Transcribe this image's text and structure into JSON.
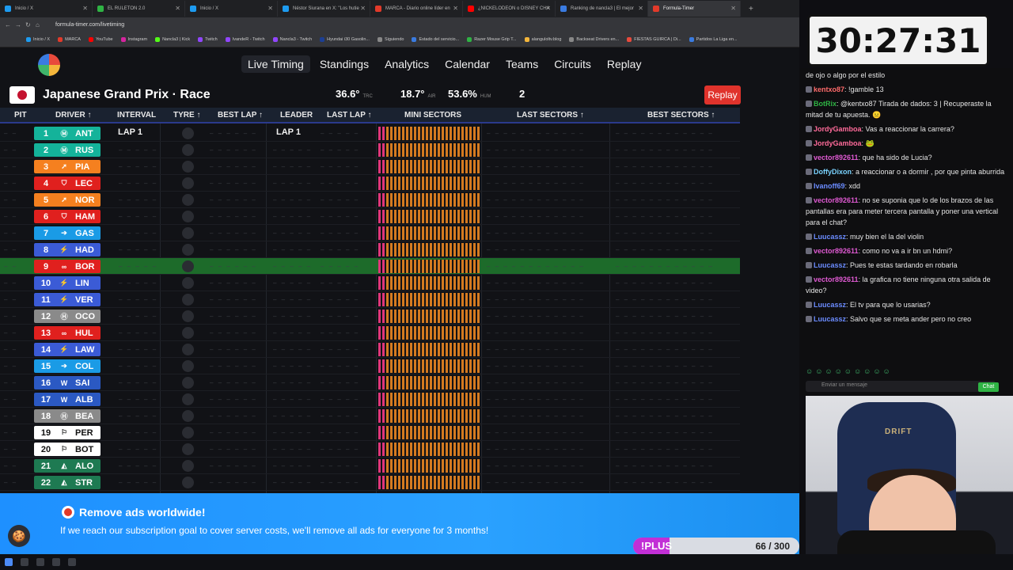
{
  "browser": {
    "tabs": [
      {
        "label": "Inicio / X",
        "color": "#1d9bf0"
      },
      {
        "label": "EL RULETON 2.0",
        "color": "#2fb344"
      },
      {
        "label": "Inicio / X",
        "color": "#1d9bf0"
      },
      {
        "label": "Néstor Siurana en X: \"Los hutie",
        "color": "#1d9bf0"
      },
      {
        "label": "MARCA - Diario online líder en",
        "color": "#e23a2a"
      },
      {
        "label": "¿NICKELODEON o DISNEY CHA",
        "color": "#ff0000"
      },
      {
        "label": "Ranking de nancla3 | El mejor",
        "color": "#3a7be0"
      },
      {
        "label": "Formula-Timer",
        "color": "#e23a2a",
        "active": true
      }
    ],
    "url": "formula-timer.com/livetiming",
    "bookmarks": [
      "Inicio / X",
      "MARCA",
      "YouTube",
      "Instagram",
      "Nancla3 | Kick",
      "Twitch",
      "IvandeR - Twitch",
      "Nancla3 - Twitch",
      "Hyundai i30 Gasolin...",
      "Siguiendo",
      "Estado del servicio...",
      "Razer Mouse Grip T...",
      "alanguloltv.blog",
      "Backseat Drivers en...",
      "FIESTAS GUIRCA | Di...",
      "Partidos La Liga en..."
    ]
  },
  "site": {
    "nav": [
      "Live Timing",
      "Standings",
      "Analytics",
      "Calendar",
      "Teams",
      "Circuits",
      "Replay"
    ],
    "race_title": "Japanese Grand Prix · Race",
    "weather": [
      {
        "value": "36.6°",
        "label": "TRC"
      },
      {
        "value": "18.7°",
        "label": "AIR"
      },
      {
        "value": "53.6%",
        "label": "HUM"
      },
      {
        "value": "2",
        "label": ""
      }
    ],
    "replay_button": "Replay",
    "columns": [
      "PIT",
      "DRIVER ↑",
      "INTERVAL",
      "TYRE ↑",
      "BEST LAP ↑",
      "LEADER",
      "LAST LAP ↑",
      "MINI SECTORS",
      "LAST SECTORS ↑",
      "BEST SECTORS ↑"
    ],
    "lap_label": "LAP 1",
    "drivers": [
      {
        "pos": "1",
        "code": "ANT",
        "color": "#14b39a",
        "logo": "Ⓜ"
      },
      {
        "pos": "2",
        "code": "RUS",
        "color": "#14b39a",
        "logo": "Ⓜ"
      },
      {
        "pos": "3",
        "code": "PIA",
        "color": "#f5801f",
        "logo": "➚"
      },
      {
        "pos": "4",
        "code": "LEC",
        "color": "#e0201e",
        "logo": "⛉"
      },
      {
        "pos": "5",
        "code": "NOR",
        "color": "#f5801f",
        "logo": "➚"
      },
      {
        "pos": "6",
        "code": "HAM",
        "color": "#e0201e",
        "logo": "⛉"
      },
      {
        "pos": "7",
        "code": "GAS",
        "color": "#1a9be6",
        "logo": "➔"
      },
      {
        "pos": "8",
        "code": "HAD",
        "color": "#3b5bd6",
        "logo": "⚡"
      },
      {
        "pos": "9",
        "code": "BOR",
        "color": "#e0201e",
        "logo": "∞"
      },
      {
        "pos": "10",
        "code": "LIN",
        "color": "#3b5bd6",
        "logo": "⚡"
      },
      {
        "pos": "11",
        "code": "VER",
        "color": "#3b5bd6",
        "logo": "⚡"
      },
      {
        "pos": "12",
        "code": "OCO",
        "color": "#8a8a8a",
        "logo": "Ⓗ"
      },
      {
        "pos": "13",
        "code": "HUL",
        "color": "#e0201e",
        "logo": "∞"
      },
      {
        "pos": "14",
        "code": "LAW",
        "color": "#3b5bd6",
        "logo": "⚡"
      },
      {
        "pos": "15",
        "code": "COL",
        "color": "#1a9be6",
        "logo": "➔"
      },
      {
        "pos": "16",
        "code": "SAI",
        "color": "#2b59c3",
        "logo": "W"
      },
      {
        "pos": "17",
        "code": "ALB",
        "color": "#2b59c3",
        "logo": "W"
      },
      {
        "pos": "18",
        "code": "BEA",
        "color": "#8a8a8a",
        "logo": "Ⓗ"
      },
      {
        "pos": "19",
        "code": "PER",
        "color": "#ffffff",
        "logo": "⚐"
      },
      {
        "pos": "20",
        "code": "BOT",
        "color": "#ffffff",
        "logo": "⚐"
      },
      {
        "pos": "21",
        "code": "ALO",
        "color": "#1e7a52",
        "logo": "◭"
      },
      {
        "pos": "22",
        "code": "STR",
        "color": "#1e7a52",
        "logo": "◭"
      }
    ],
    "highlight_row": 9,
    "banner": {
      "title": "Remove ads worldwide!",
      "text": "If we reach our subscription goal to cover server costs, we'll remove all ads for everyone for 3 months!",
      "plus_label": "!PLUS",
      "plus_count": "66 / 300",
      "plus_progress": 0.22
    }
  },
  "overlay": {
    "timer": "30:27:31",
    "chat": [
      {
        "user": "",
        "color": "#e6e6e6",
        "text": "de ojo o algo por el estilo"
      },
      {
        "user": "kentxo87",
        "color": "#ff6b6b",
        "text": "!gamble 13"
      },
      {
        "user": "BotRix",
        "color": "#2fb344",
        "text": "@kentxo87 Tirada de dados: 3 | Recuperaste la mitad de tu apuesta. 😐"
      },
      {
        "user": "JordyGamboa",
        "color": "#ff6b9a",
        "text": "Vas a reaccionar la carrera?"
      },
      {
        "user": "JordyGamboa",
        "color": "#ff6b9a",
        "text": "🐸"
      },
      {
        "user": "vector892611",
        "color": "#e05ad3",
        "text": "que ha sido de Lucia?"
      },
      {
        "user": "DoffyDixon",
        "color": "#7ad3ff",
        "text": "a reaccionar o a dormir , por que pinta aburrida"
      },
      {
        "user": "Ivanoff69",
        "color": "#6b8cff",
        "text": "xdd"
      },
      {
        "user": "vector892611",
        "color": "#e05ad3",
        "text": "no se suponia que lo de los brazos de las pantallas era para meter tercera pantalla y poner una vertical para el chat?"
      },
      {
        "user": "Luucassz",
        "color": "#6b8cff",
        "text": "muy bien el la del violin"
      },
      {
        "user": "vector892611",
        "color": "#e05ad3",
        "text": "como no va a ir bn un hdmi?"
      },
      {
        "user": "Luucassz",
        "color": "#6b8cff",
        "text": "Pues te estas tardando en robarla"
      },
      {
        "user": "vector892611",
        "color": "#e05ad3",
        "text": "la grafica no tiene ninguna otra salida de video?"
      },
      {
        "user": "Luucassz",
        "color": "#6b8cff",
        "text": "El tv para que lo usarias?"
      },
      {
        "user": "Luucassz",
        "color": "#6b8cff",
        "text": "Salvo que se meta ander pero no creo"
      }
    ],
    "chat_placeholder": "Enviar un mensaje",
    "chat_button": "Chat",
    "chair_text": "DRIFT"
  }
}
